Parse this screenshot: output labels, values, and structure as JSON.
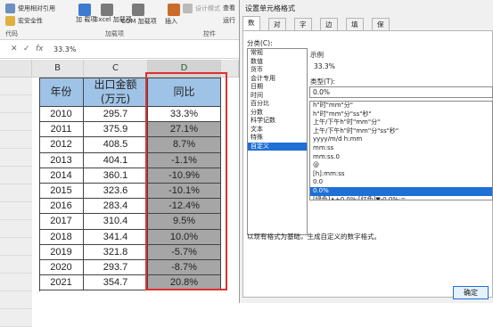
{
  "ribbon": {
    "macro_security": "使用相对引用",
    "macro_security2": "宏安全性",
    "addins_label": "加\n载项",
    "excel_addins": "Excel\n加载项",
    "com_addins": "COM 加载项",
    "insert_label": "插入",
    "design_mode": "设计模式",
    "view_code": "查看",
    "run_dialog": "运行",
    "group_code": "代码",
    "group_addins": "加载项",
    "group_controls": "控件"
  },
  "formula_bar": {
    "cancel": "✕",
    "enter": "✓",
    "fx": "fx",
    "value": "33.3%"
  },
  "sheet": {
    "columns": [
      "B",
      "C",
      "D"
    ],
    "header": {
      "year": "年份",
      "amount_line1": "出口金额",
      "amount_line2": "(万元)",
      "yoy": "同比"
    },
    "rows": [
      {
        "year": "2010",
        "amount": "295.7",
        "yoy": "33.3%"
      },
      {
        "year": "2011",
        "amount": "375.9",
        "yoy": "27.1%"
      },
      {
        "year": "2012",
        "amount": "408.5",
        "yoy": "8.7%"
      },
      {
        "year": "2013",
        "amount": "404.1",
        "yoy": "-1.1%"
      },
      {
        "year": "2014",
        "amount": "360.1",
        "yoy": "-10.9%"
      },
      {
        "year": "2015",
        "amount": "323.6",
        "yoy": "-10.1%"
      },
      {
        "year": "2016",
        "amount": "283.4",
        "yoy": "-12.4%"
      },
      {
        "year": "2017",
        "amount": "310.4",
        "yoy": "9.5%"
      },
      {
        "year": "2018",
        "amount": "341.4",
        "yoy": "10.0%"
      },
      {
        "year": "2019",
        "amount": "321.8",
        "yoy": "-5.7%"
      },
      {
        "year": "2020",
        "amount": "293.7",
        "yoy": "-8.7%"
      },
      {
        "year": "2021",
        "amount": "354.7",
        "yoy": "20.8%"
      }
    ]
  },
  "dialog": {
    "title": "设置单元格格式",
    "tabs": [
      "数字",
      "对齐",
      "字体",
      "边框",
      "填充",
      "保护"
    ],
    "category_label": "分类(C):",
    "categories": [
      "常规",
      "数值",
      "货币",
      "会计专用",
      "日期",
      "时间",
      "百分比",
      "分数",
      "科学记数",
      "文本",
      "特殊",
      "自定义"
    ],
    "selected_category": 11,
    "sample_label": "示例",
    "sample_value": "33.3%",
    "type_label": "类型(T):",
    "type_value": "0.0%",
    "formats": [
      "h\"时\"mm\"分\"",
      "h\"时\"mm\"分\"ss\"秒\"",
      "上午/下午h\"时\"mm\"分\"",
      "上午/下午h\"时\"mm\"分\"ss\"秒\"",
      "yyyy/m/d h:mm",
      "mm:ss",
      "mm:ss.0",
      "@",
      "[h]:mm:ss",
      "0.0",
      "0.0%",
      "[绿色]▲+0.0%;[红色]▼-0.0%;="
    ],
    "selected_format": 10,
    "note": "以现有格式为基础，生成自定义的数字格式。",
    "ok_label": "确定"
  }
}
